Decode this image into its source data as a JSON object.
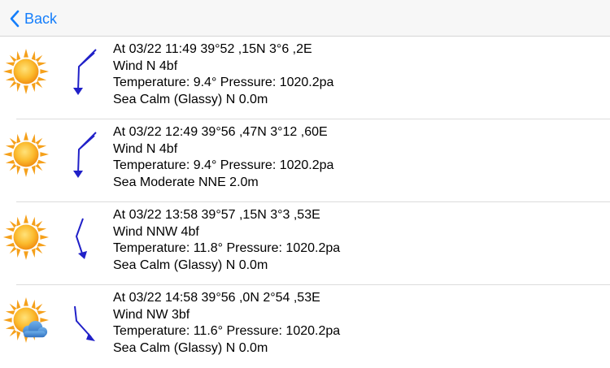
{
  "nav": {
    "back_label": "Back"
  },
  "rows": [
    {
      "line1": "At 03/22 11:49 39°52 ,15N 3°6 ,2E",
      "line2": "Wind N 4bf",
      "line3": "Temperature: 9.4° Pressure: 1020.2pa",
      "line4": "Sea Calm (Glassy) N 0.0m",
      "weather_icon": "sun-icon",
      "wind_icon": "wind-barb-north-icon"
    },
    {
      "line1": "At 03/22 12:49 39°56 ,47N 3°12 ,60E",
      "line2": "Wind N 4bf",
      "line3": "Temperature: 9.4° Pressure: 1020.2pa",
      "line4": "Sea Moderate NNE 2.0m",
      "weather_icon": "sun-icon",
      "wind_icon": "wind-barb-north-icon"
    },
    {
      "line1": "At 03/22 13:58 39°57 ,15N 3°3 ,53E",
      "line2": "Wind NNW 4bf",
      "line3": "Temperature: 11.8° Pressure: 1020.2pa",
      "line4": "Sea Calm (Glassy) N 0.0m",
      "weather_icon": "sun-icon",
      "wind_icon": "wind-barb-nnw-icon"
    },
    {
      "line1": "At 03/22 14:58 39°56 ,0N 2°54 ,53E",
      "line2": "Wind NW 3bf",
      "line3": "Temperature: 11.6° Pressure: 1020.2pa",
      "line4": "Sea Calm (Glassy) N 0.0m",
      "weather_icon": "sun-cloud-icon",
      "wind_icon": "wind-barb-northwest-icon"
    }
  ],
  "colors": {
    "accent": "#147efb",
    "wind": "#2020c8",
    "sun": "#f7a21b"
  }
}
